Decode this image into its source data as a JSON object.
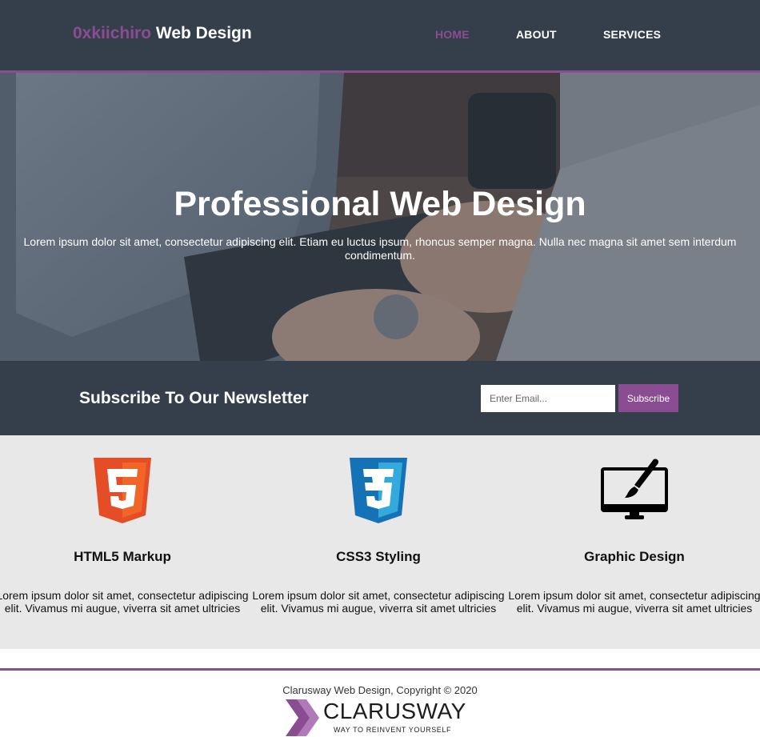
{
  "header": {
    "brand_highlight": "0xkiichiro",
    "brand_rest": " Web Design",
    "nav": [
      {
        "label": "HOME",
        "active": true
      },
      {
        "label": "ABOUT",
        "active": false
      },
      {
        "label": "SERVICES",
        "active": false
      }
    ]
  },
  "hero": {
    "title": "Professional Web Design",
    "text": "Lorem ipsum dolor sit amet, consectetur adipiscing elit. Etiam eu luctus ipsum, rhoncus semper magna. Nulla nec magna sit amet sem interdum condimentum."
  },
  "newsletter": {
    "title": "Subscribe To Our Newsletter",
    "email_placeholder": "Enter Email...",
    "button_label": "Subscribe"
  },
  "features": [
    {
      "icon": "html5-icon",
      "title": "HTML5 Markup",
      "text": "Lorem ipsum dolor sit amet, consectetur adipiscing elit. Vivamus mi augue, viverra sit amet ultricies"
    },
    {
      "icon": "css3-icon",
      "title": "CSS3 Styling",
      "text": "Lorem ipsum dolor sit amet, consectetur adipiscing elit. Vivamus mi augue, viverra sit amet ultricies"
    },
    {
      "icon": "graphic-design-icon",
      "title": "Graphic Design",
      "text": "Lorem ipsum dolor sit amet, consectetur adipiscing elit. Vivamus mi augue, viverra sit amet ultricies"
    }
  ],
  "footer": {
    "copyright": "Clarusway Web Design, Copyright © 2020",
    "logo_word": "CLARUSWAY",
    "logo_tagline": "WAY TO REINVENT YOURSELF"
  },
  "colors": {
    "accent": "#8a4d92",
    "dark": "#343f4b",
    "light_bg": "#e8e8e8"
  }
}
